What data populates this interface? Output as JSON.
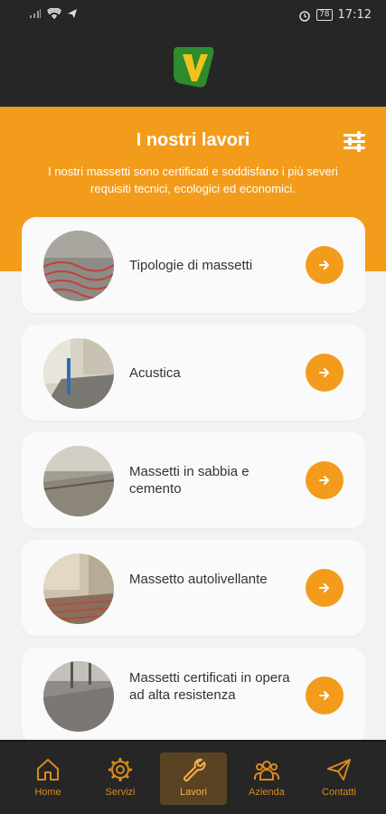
{
  "status_bar": {
    "time": "17:12",
    "battery": "78"
  },
  "hero": {
    "title": "I nostri lavori",
    "subtitle": "I nostri massetti sono certificati e soddisfano i più severi requisiti tecnici, ecologici ed economici."
  },
  "works": [
    {
      "label": "Tipologie di massetti"
    },
    {
      "label": "Acustica"
    },
    {
      "label": "Massetti in sabbia e cemento"
    },
    {
      "label": "Massetto autolivellante"
    },
    {
      "label": "Massetti certificati in opera ad alta resistenza"
    }
  ],
  "nav": {
    "items": [
      {
        "label": "Home"
      },
      {
        "label": "Servizi"
      },
      {
        "label": "Lavori"
      },
      {
        "label": "Azienda"
      },
      {
        "label": "Contatti"
      }
    ],
    "active": "Lavori"
  },
  "colors": {
    "accent": "#f39c1c",
    "dark": "#262626",
    "nav_active_bg": "#5a4323"
  }
}
